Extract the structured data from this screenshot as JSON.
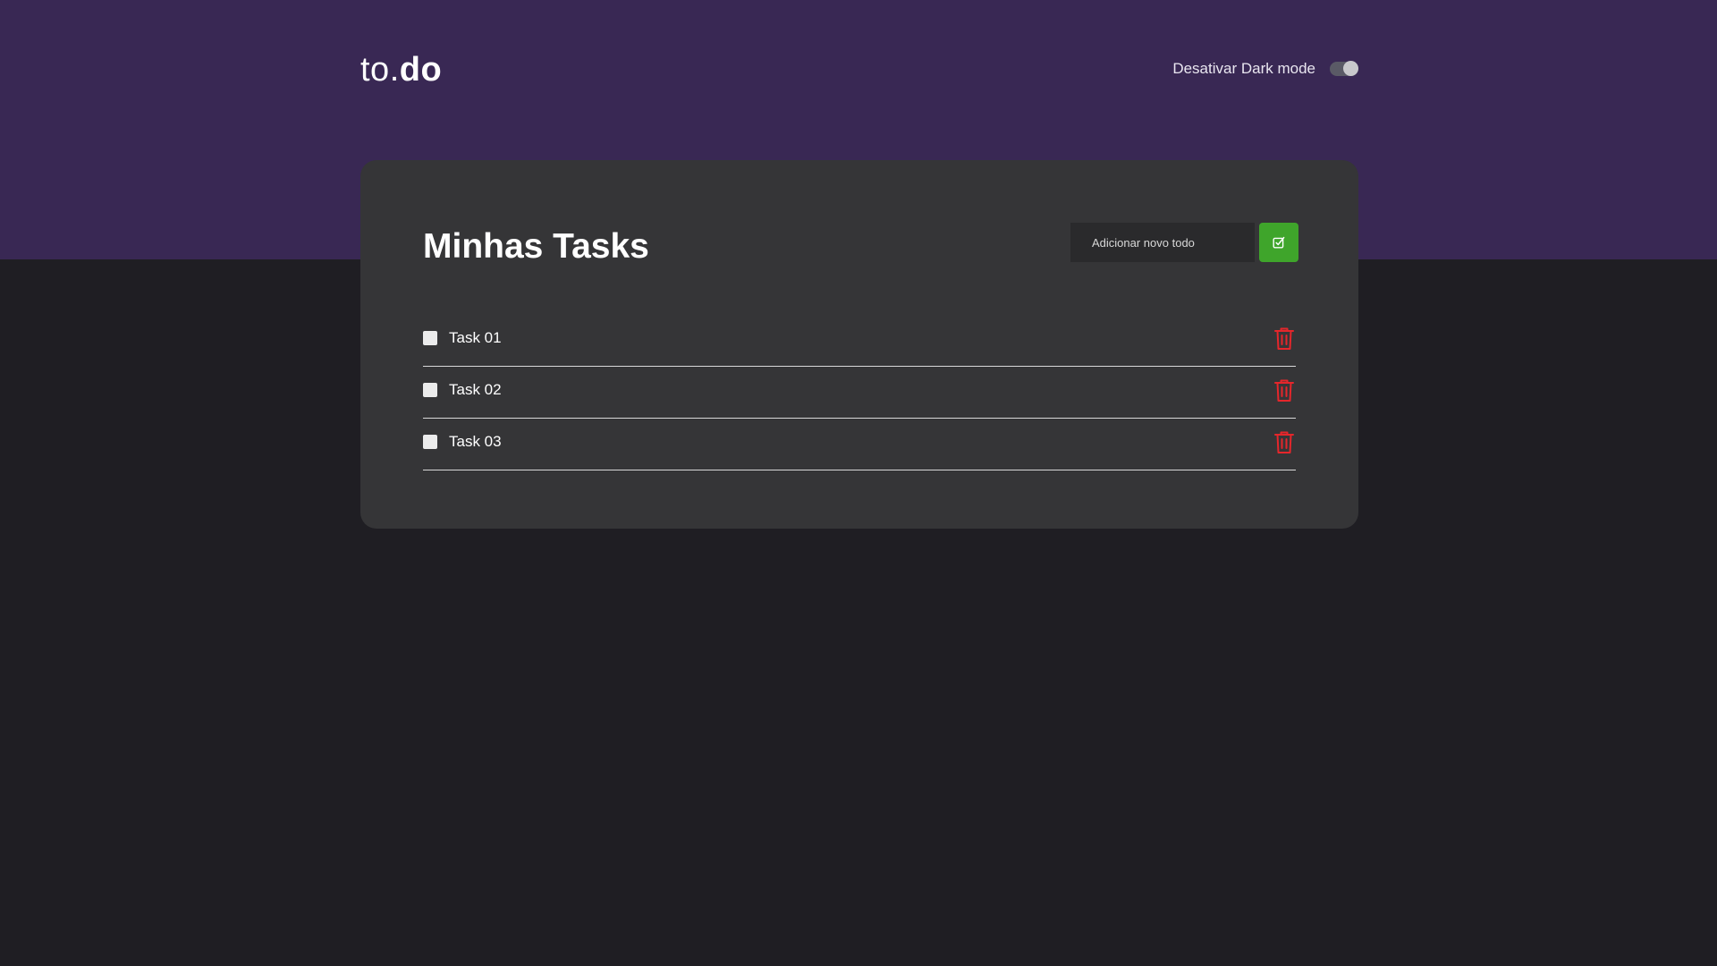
{
  "header": {
    "logo": {
      "part1": "to",
      "dot": ".",
      "part2": "do"
    },
    "dark_mode_label": "Desativar Dark mode",
    "dark_mode_enabled": true
  },
  "main": {
    "title": "Minhas Tasks",
    "new_todo_placeholder": "Adicionar novo todo",
    "add_button_icon": "check-square-icon",
    "tasks": [
      {
        "label": "Task 01",
        "done": false
      },
      {
        "label": "Task 02",
        "done": false
      },
      {
        "label": "Task 03",
        "done": false
      }
    ],
    "delete_icon": "trash-icon"
  },
  "colors": {
    "header_background": "#392854",
    "page_background": "#1f1e23",
    "card_background": "#353537",
    "accent_green": "#3fa52b",
    "delete_red": "#e5262b"
  }
}
